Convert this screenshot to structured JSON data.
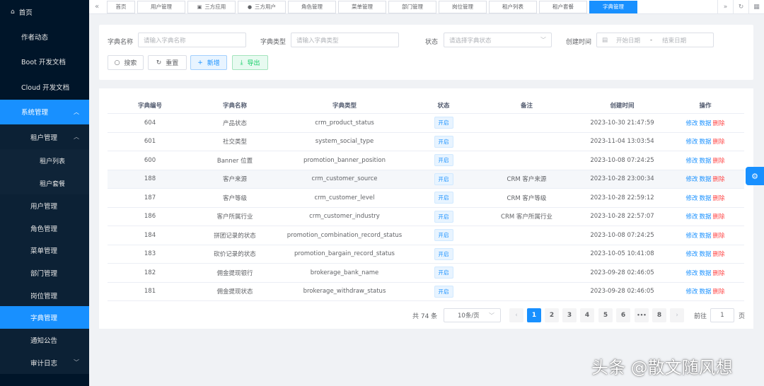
{
  "sidebar": {
    "home": "首页",
    "items": [
      {
        "label": "作者动态"
      },
      {
        "label": "Boot 开发文档"
      },
      {
        "label": "Cloud 开发文档"
      }
    ],
    "system": "系统管理",
    "tenant": "租户管理",
    "tenant_children": [
      "租户列表",
      "租户套餐"
    ],
    "system_children": [
      "用户管理",
      "角色管理",
      "菜单管理",
      "部门管理",
      "岗位管理",
      "字典管理",
      "通知公告",
      "审计日志"
    ]
  },
  "tabs": [
    "首页",
    "用户管理",
    "三方应用",
    "三方用户",
    "角色管理",
    "菜单管理",
    "部门管理",
    "岗位管理",
    "租户列表",
    "租户套餐",
    "字典管理"
  ],
  "search": {
    "name_label": "字典名称",
    "name_placeholder": "请输入字典名称",
    "type_label": "字典类型",
    "type_placeholder": "请输入字典类型",
    "status_label": "状态",
    "status_placeholder": "请选择字典状态",
    "time_label": "创建时间",
    "start_placeholder": "开始日期",
    "date_sep": "-",
    "end_placeholder": "结束日期",
    "btn_search": "搜索",
    "btn_reset": "重置",
    "btn_add": "新增",
    "btn_export": "导出"
  },
  "table": {
    "headers": [
      "字典编号",
      "字典名称",
      "字典类型",
      "状态",
      "备注",
      "创建时间",
      "操作"
    ],
    "rows": [
      {
        "id": "604",
        "name": "产品状态",
        "type": "crm_product_status",
        "status": "开启",
        "remark": "",
        "time": "2023-10-30 21:47:59"
      },
      {
        "id": "601",
        "name": "社交类型",
        "type": "system_social_type",
        "status": "开启",
        "remark": "",
        "time": "2023-11-04 13:03:54"
      },
      {
        "id": "600",
        "name": "Banner 位置",
        "type": "promotion_banner_position",
        "status": "开启",
        "remark": "",
        "time": "2023-10-08 07:24:25"
      },
      {
        "id": "188",
        "name": "客户来源",
        "type": "crm_customer_source",
        "status": "开启",
        "remark": "CRM 客户来源",
        "time": "2023-10-28 23:00:34"
      },
      {
        "id": "187",
        "name": "客户等级",
        "type": "crm_customer_level",
        "status": "开启",
        "remark": "CRM 客户等级",
        "time": "2023-10-28 22:59:12"
      },
      {
        "id": "186",
        "name": "客户所属行业",
        "type": "crm_customer_industry",
        "status": "开启",
        "remark": "CRM 客户所属行业",
        "time": "2023-10-28 22:57:07"
      },
      {
        "id": "184",
        "name": "拼团记录的状态",
        "type": "promotion_combination_record_status",
        "status": "开启",
        "remark": "",
        "time": "2023-10-08 07:24:25"
      },
      {
        "id": "183",
        "name": "砍价记录的状态",
        "type": "promotion_bargain_record_status",
        "status": "开启",
        "remark": "",
        "time": "2023-10-05 10:41:08"
      },
      {
        "id": "182",
        "name": "佣金提现银行",
        "type": "brokerage_bank_name",
        "status": "开启",
        "remark": "",
        "time": "2023-09-28 02:46:05"
      },
      {
        "id": "181",
        "name": "佣金提现状态",
        "type": "brokerage_withdraw_status",
        "status": "开启",
        "remark": "",
        "time": "2023-09-28 02:46:05"
      }
    ],
    "ops": [
      "修改",
      "数据",
      "删除"
    ]
  },
  "pagination": {
    "total": "共 74 条",
    "page_size": "10条/页",
    "pages": [
      "1",
      "2",
      "3",
      "4",
      "5",
      "6",
      "8"
    ],
    "ellipsis": "•••",
    "goto": "前往",
    "jump_value": "1",
    "page_suffix": "页"
  },
  "watermark": "头条 @散文随风想",
  "colors": {
    "sidebar_bg": "#001529",
    "primary": "#1890ff",
    "danger": "#ff4949",
    "success": "#13ce66"
  }
}
